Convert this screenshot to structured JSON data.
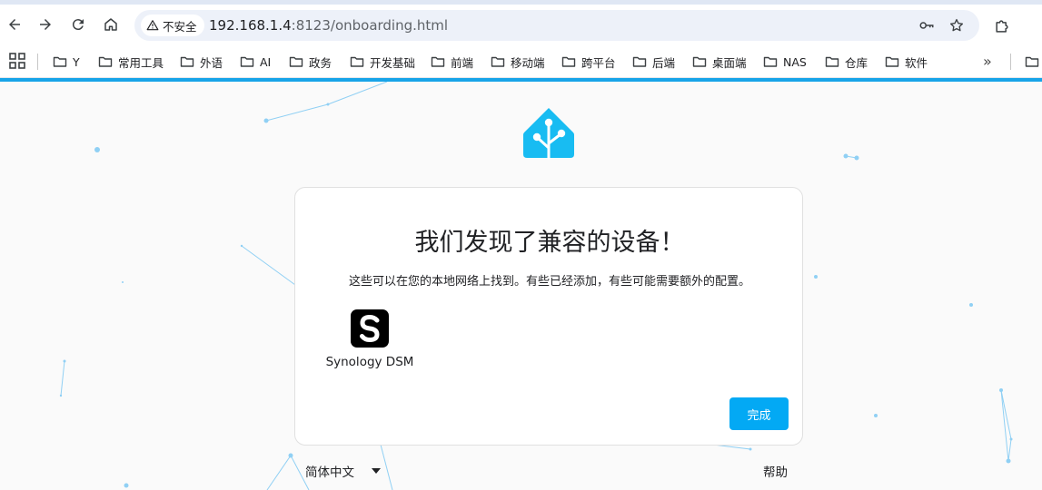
{
  "browser": {
    "security_label": "不安全",
    "url_host": "192.168.1.4",
    "url_rest": ":8123/onboarding.html",
    "bookmarks": [
      {
        "label": "Y"
      },
      {
        "label": "常用工具"
      },
      {
        "label": "外语"
      },
      {
        "label": "AI"
      },
      {
        "label": "政务"
      },
      {
        "label": "开发基础"
      },
      {
        "label": "前端"
      },
      {
        "label": "移动端"
      },
      {
        "label": "跨平台"
      },
      {
        "label": "后端"
      },
      {
        "label": "桌面端"
      },
      {
        "label": "NAS"
      },
      {
        "label": "仓库"
      },
      {
        "label": "软件"
      }
    ],
    "more_glyph": "»"
  },
  "onboarding": {
    "title": "我们发现了兼容的设备！",
    "description": "这些可以在您的本地网络上找到。有些已经添加，有些可能需要额外的配置。",
    "devices": [
      {
        "name": "Synology DSM",
        "icon": "synology-logo-icon"
      }
    ],
    "finish_label": "完成"
  },
  "footer": {
    "language": "简体中文",
    "help_label": "帮助"
  },
  "colors": {
    "accent": "#18a4e8",
    "button": "#03a9f4",
    "logo": "#18bcf2"
  }
}
